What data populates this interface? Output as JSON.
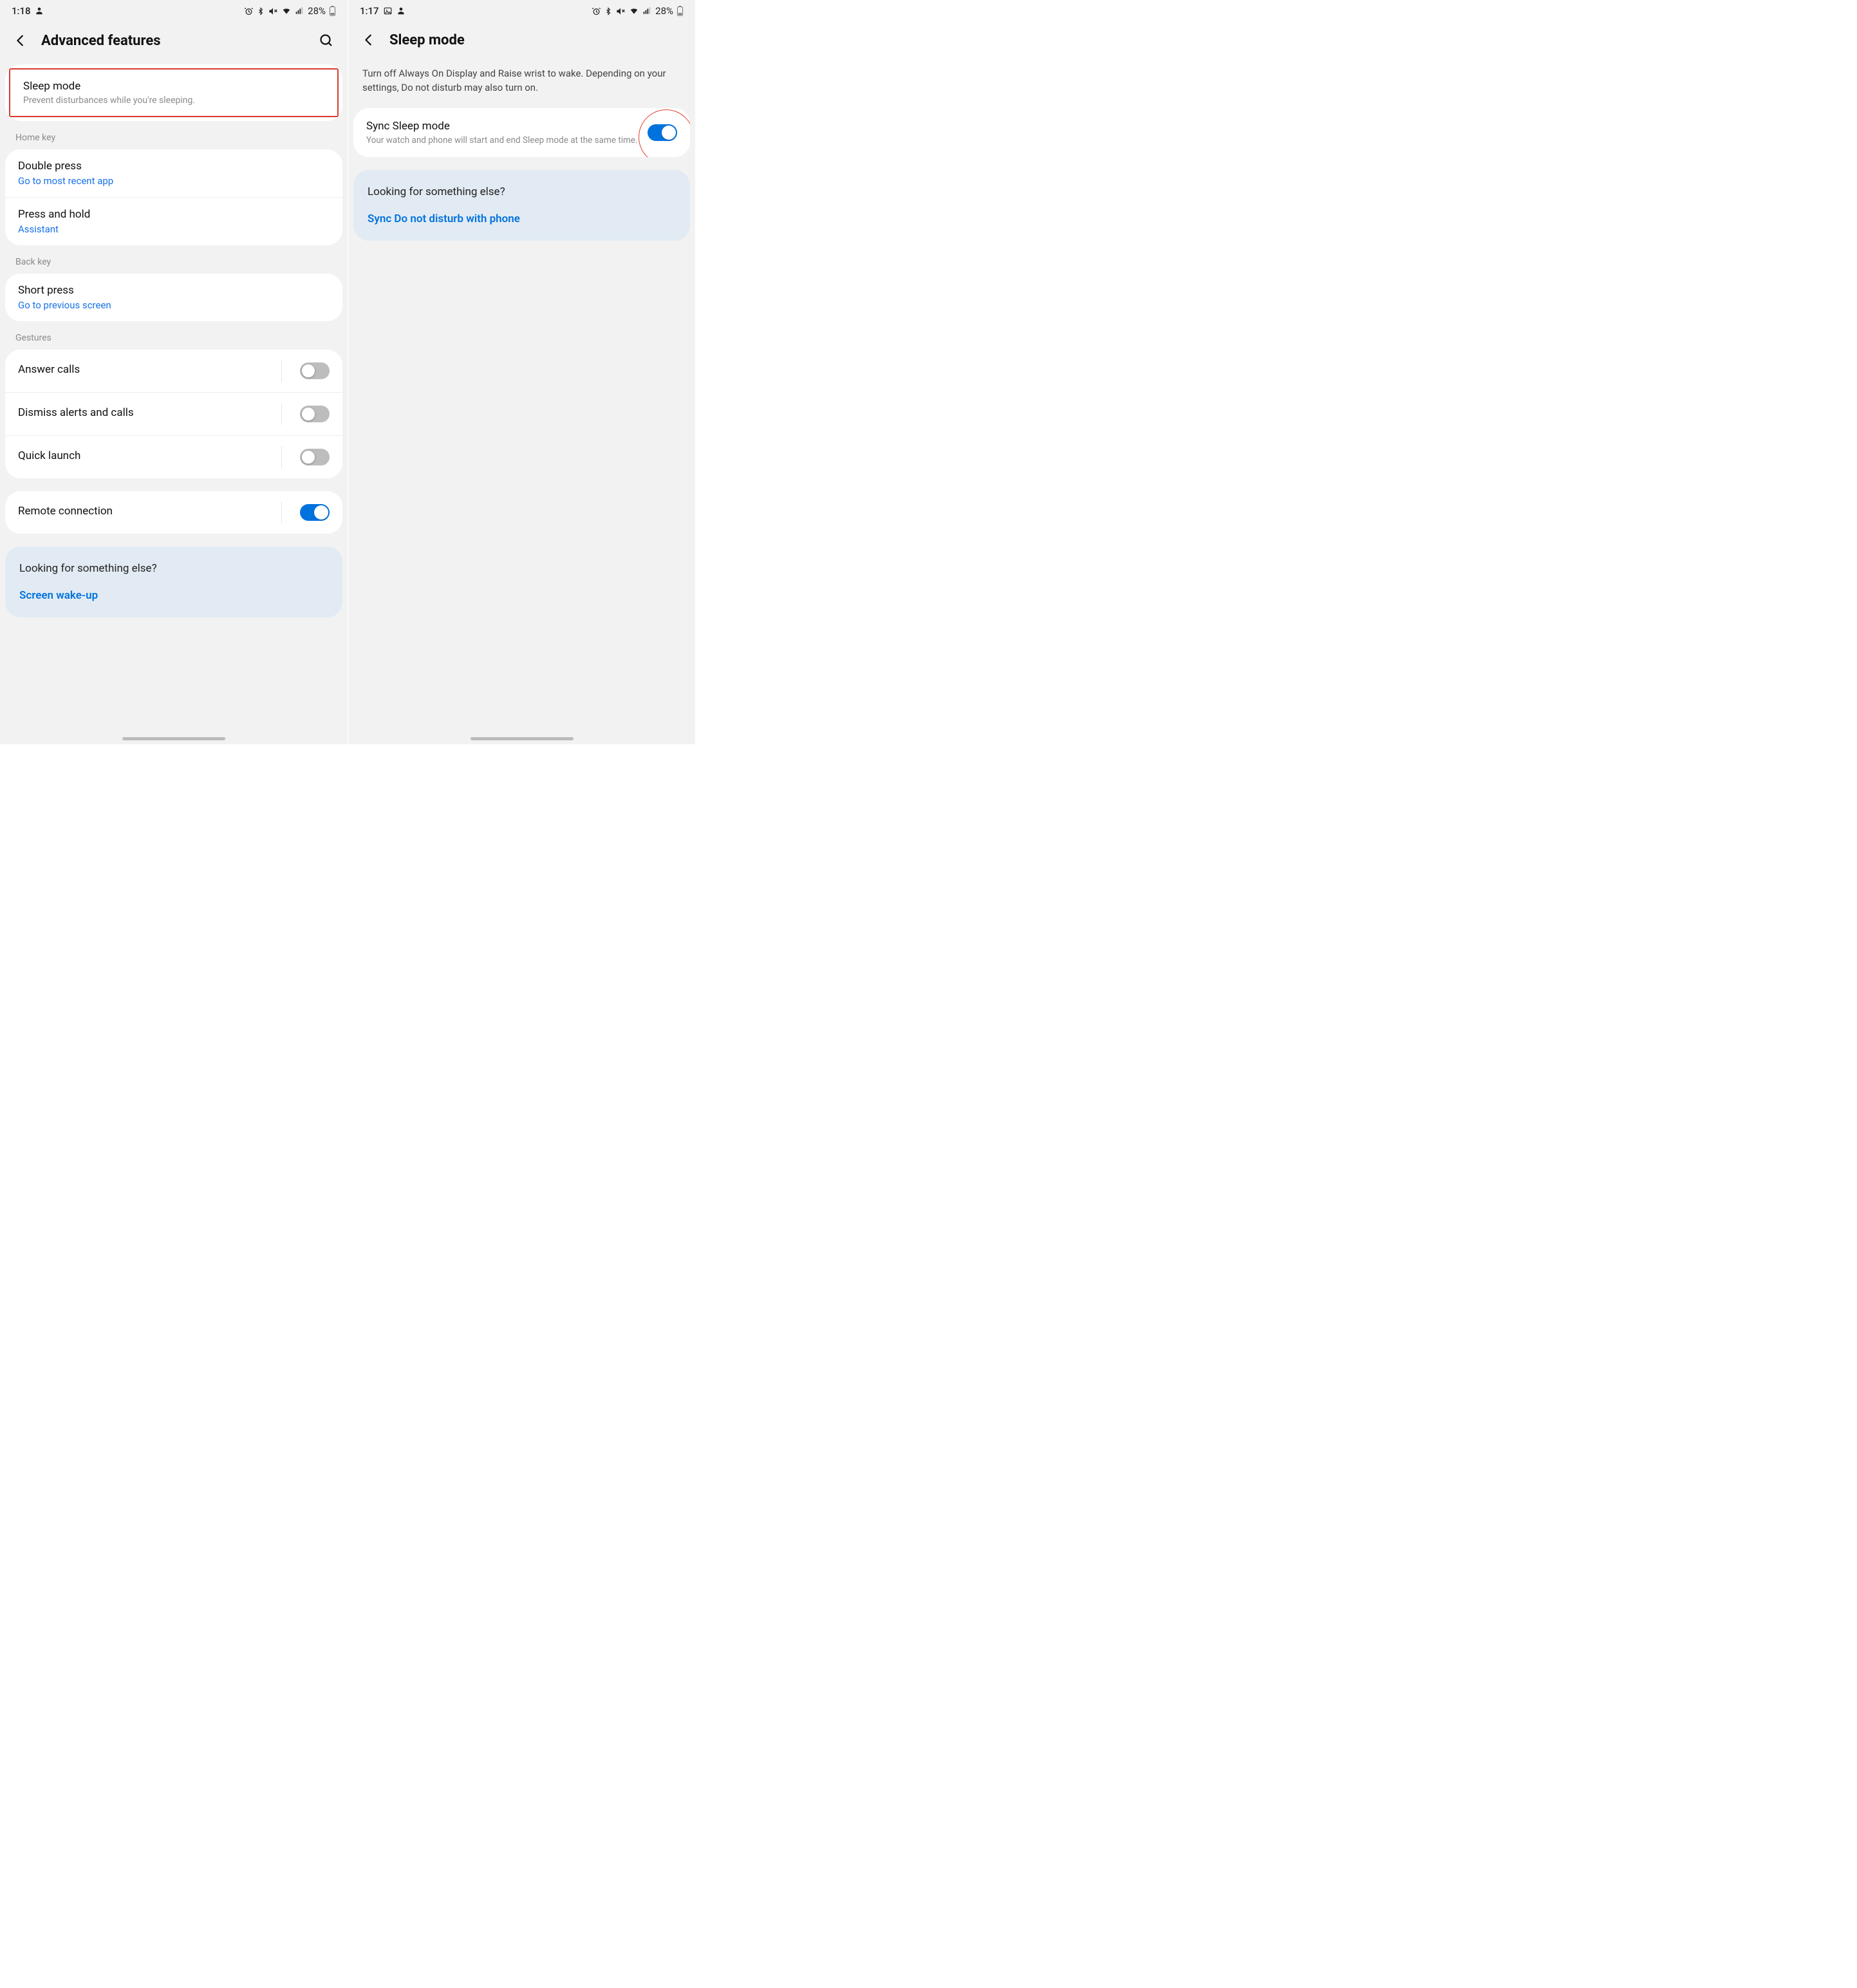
{
  "left": {
    "status": {
      "time": "1:18",
      "battery_pct": "28%"
    },
    "header": {
      "title": "Advanced features"
    },
    "sleep_mode": {
      "title": "Sleep mode",
      "sub": "Prevent disturbances while you're sleeping."
    },
    "section_home_key": "Home key",
    "double_press": {
      "title": "Double press",
      "sub": "Go to most recent app"
    },
    "press_hold": {
      "title": "Press and hold",
      "sub": "Assistant"
    },
    "section_back_key": "Back key",
    "short_press": {
      "title": "Short press",
      "sub": "Go to previous screen"
    },
    "section_gestures": "Gestures",
    "answer_calls": {
      "title": "Answer calls"
    },
    "dismiss_alerts": {
      "title": "Dismiss alerts and calls"
    },
    "quick_launch": {
      "title": "Quick launch"
    },
    "remote_conn": {
      "title": "Remote connection"
    },
    "lfse": {
      "title": "Looking for something else?",
      "link": "Screen wake-up"
    }
  },
  "right": {
    "status": {
      "time": "1:17",
      "battery_pct": "28%"
    },
    "header": {
      "title": "Sleep mode"
    },
    "description": "Turn off Always On Display and Raise wrist to wake. Depending on your settings, Do not disturb may also turn on.",
    "sync": {
      "title": "Sync Sleep mode",
      "sub": "Your watch and phone will start and end Sleep mode at the same time."
    },
    "lfse": {
      "title": "Looking for something else?",
      "link": "Sync Do not disturb with phone"
    }
  }
}
